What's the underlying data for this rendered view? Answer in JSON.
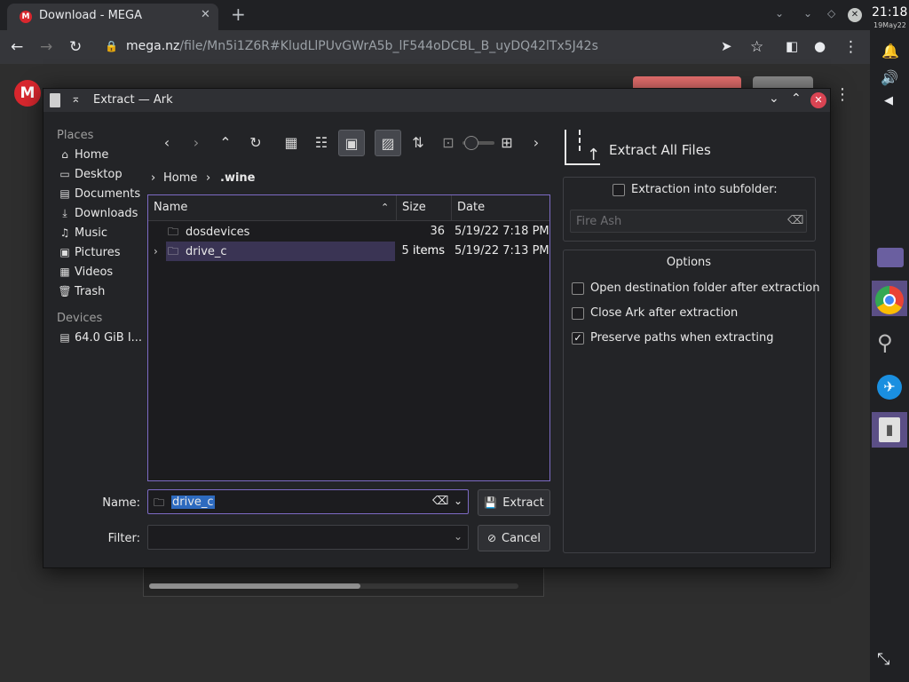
{
  "browser": {
    "tab_title": "Download - MEGA",
    "tab_favicon": "M",
    "url_host": "mega.nz",
    "url_path": "/file/Mn5i1Z6R#KludLlPUvGWrA5b_lF544oDCBL_B_uyDQ42lTx5J42s"
  },
  "shelf": {
    "time": "21:18",
    "date": "19May22"
  },
  "page": {
    "logo_letter": "M"
  },
  "dialog": {
    "title": "Extract — Ark",
    "places_label": "Places",
    "places": [
      {
        "icon": "home-icon",
        "glyph": "⌂",
        "label": "Home"
      },
      {
        "icon": "desktop-icon",
        "glyph": "▭",
        "label": "Desktop"
      },
      {
        "icon": "documents-icon",
        "glyph": "▤",
        "label": "Documents"
      },
      {
        "icon": "downloads-icon",
        "glyph": "⤓",
        "label": "Downloads"
      },
      {
        "icon": "music-icon",
        "glyph": "♫",
        "label": "Music"
      },
      {
        "icon": "pictures-icon",
        "glyph": "▣",
        "label": "Pictures"
      },
      {
        "icon": "videos-icon",
        "glyph": "▦",
        "label": "Videos"
      },
      {
        "icon": "trash-icon",
        "glyph": "🗑",
        "label": "Trash"
      }
    ],
    "devices_label": "Devices",
    "devices": [
      {
        "icon": "drive-icon",
        "glyph": "▤",
        "label": "64.0 GiB I..."
      }
    ],
    "breadcrumb": [
      "Home",
      ".wine"
    ],
    "columns": {
      "name": "Name",
      "size": "Size",
      "date": "Date"
    },
    "files": [
      {
        "name": "dosdevices",
        "size": "36 items",
        "date": "5/19/22 7:18 PM",
        "selected": false
      },
      {
        "name": "drive_c",
        "size": "5 items",
        "date": "5/19/22 7:13 PM",
        "selected": true
      }
    ],
    "name_label": "Name:",
    "name_value": "drive_c",
    "filter_label": "Filter:",
    "filter_value": "",
    "extract_button": "Extract",
    "cancel_button": "Cancel",
    "extract_all_title": "Extract All Files",
    "subfolder_label": "Extraction into subfolder:",
    "subfolder_placeholder": "Fire Ash",
    "options_title": "Options",
    "options": [
      {
        "label": "Open destination folder after extraction",
        "checked": false
      },
      {
        "label": "Close Ark after extraction",
        "checked": false
      },
      {
        "label": "Preserve paths when extracting",
        "checked": true
      }
    ],
    "accent_color": "#7d6bc4"
  }
}
